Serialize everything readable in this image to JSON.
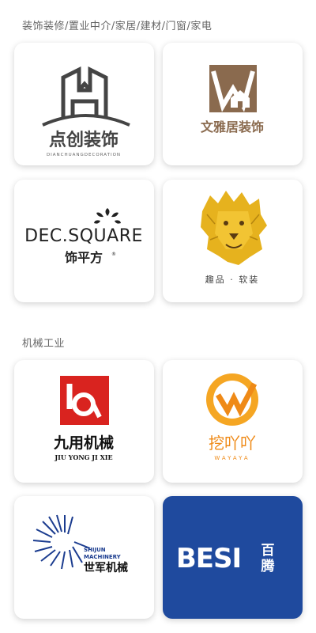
{
  "sections": [
    {
      "title": "装饰装修/置业中介/家居/建材/门窗/家电",
      "cards": [
        {
          "brand": "点创装饰",
          "sub": "DIANCHUANGDECORATION",
          "icon": "house-frame-logo-icon"
        },
        {
          "brand": "文雅居装饰",
          "icon": "house-w-logo-icon",
          "color": "#8a6a4e"
        },
        {
          "brand_en": "DEC.SQUARE",
          "brand": "饰平方",
          "icon": "chandelier-logo-icon"
        },
        {
          "brand": "趣品 · 软装",
          "icon": "lion-logo-icon"
        }
      ]
    },
    {
      "title": "机械工业",
      "cards": [
        {
          "brand": "九用机械",
          "sub": "JIU YONG JI XIE",
          "icon": "jy-square-logo-icon",
          "color": "#d9231f"
        },
        {
          "brand": "挖吖吖",
          "sub": "WAYAYA",
          "icon": "wa-circle-logo-icon",
          "color": "#ef8a17"
        },
        {
          "brand_en_1": "SHIJUN",
          "brand_en_2": "MACHINERY",
          "brand": "世军机械",
          "icon": "spiral-logo-icon",
          "color": "#1b3c8f"
        },
        {
          "brand_en": "BESI",
          "brand": "百腾",
          "icon": "besi-logo-icon",
          "color": "#1f4a9e"
        }
      ]
    }
  ]
}
